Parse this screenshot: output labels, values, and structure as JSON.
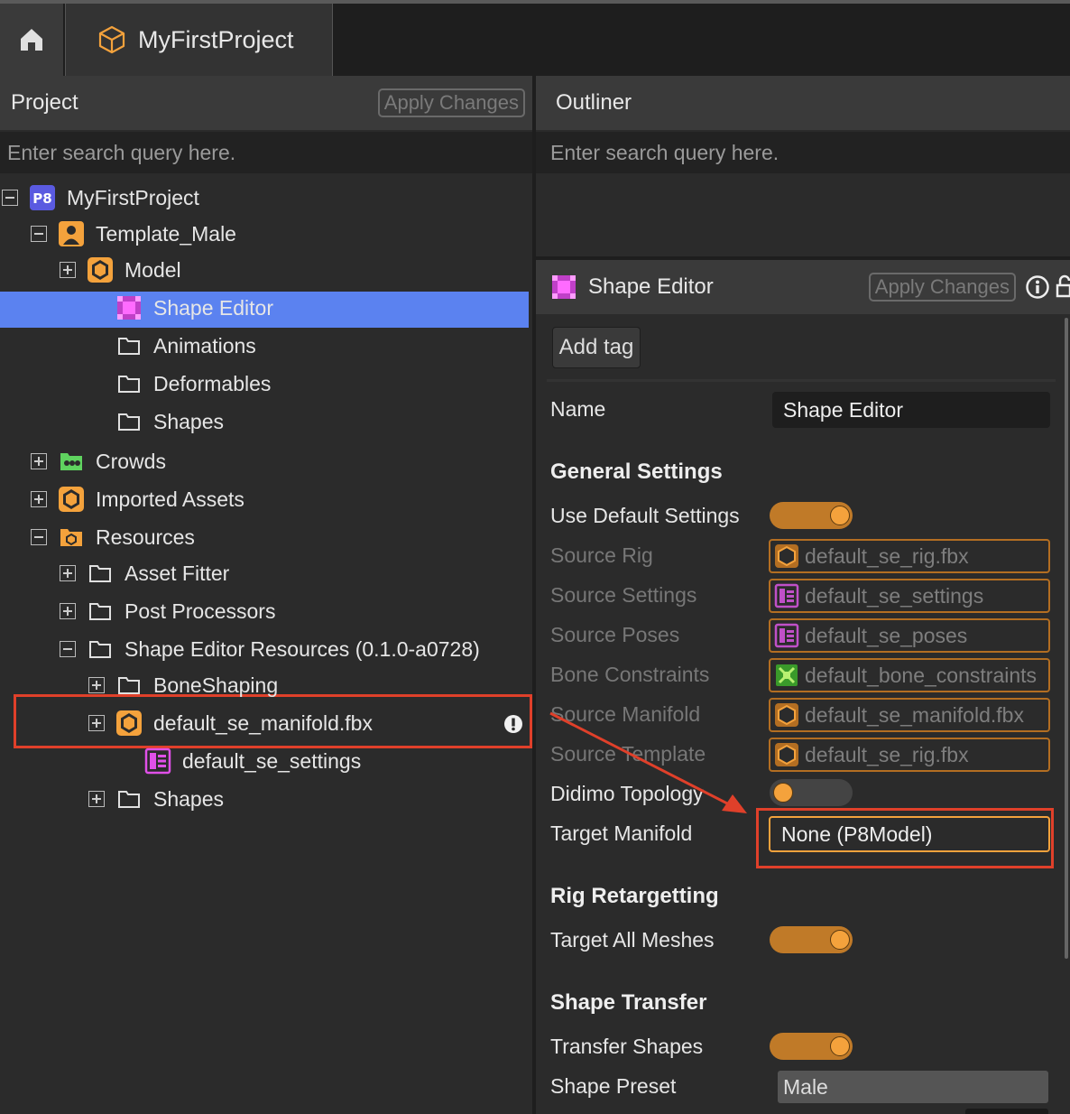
{
  "tab": {
    "title": "MyFirstProject"
  },
  "project_panel": {
    "title": "Project",
    "apply_label": "Apply Changes",
    "search_placeholder": "Enter search query here.",
    "tree": [
      {
        "label": "MyFirstProject",
        "icon": "p8-project-icon",
        "expander": "minus"
      },
      {
        "label": "Template_Male",
        "icon": "person-icon",
        "expander": "minus"
      },
      {
        "label": "Model",
        "icon": "hexagon-icon",
        "expander": "plus"
      },
      {
        "label": "Shape Editor",
        "icon": "shape-editor-icon",
        "expander": "none",
        "selected": true
      },
      {
        "label": "Animations",
        "icon": "folder-icon",
        "expander": "none"
      },
      {
        "label": "Deformables",
        "icon": "folder-icon",
        "expander": "none"
      },
      {
        "label": "Shapes",
        "icon": "folder-icon",
        "expander": "none"
      },
      {
        "label": "Crowds",
        "icon": "crowd-icon",
        "expander": "plus"
      },
      {
        "label": "Imported Assets",
        "icon": "hexagon-icon",
        "expander": "plus"
      },
      {
        "label": "Resources",
        "icon": "resources-folder-icon",
        "expander": "minus"
      },
      {
        "label": "Asset Fitter",
        "icon": "folder-icon",
        "expander": "plus"
      },
      {
        "label": "Post Processors",
        "icon": "folder-icon",
        "expander": "plus"
      },
      {
        "label": "Shape Editor Resources (0.1.0-a0728)",
        "icon": "folder-icon",
        "expander": "minus"
      },
      {
        "label": "BoneShaping",
        "icon": "folder-icon",
        "expander": "plus"
      },
      {
        "label": "default_se_manifold.fbx",
        "icon": "hexagon-icon",
        "expander": "plus",
        "warning": true
      },
      {
        "label": "default_se_settings",
        "icon": "settings-asset-icon",
        "expander": "none"
      },
      {
        "label": "Shapes",
        "icon": "folder-icon",
        "expander": "plus"
      }
    ]
  },
  "outliner": {
    "title": "Outliner",
    "search_placeholder": "Enter search query here."
  },
  "inspector": {
    "title": "Shape Editor",
    "apply_label": "Apply Changes",
    "add_tag_label": "Add tag",
    "name_label": "Name",
    "name_value": "Shape Editor",
    "general_settings": "General Settings",
    "use_default_settings": "Use Default Settings",
    "source_rig": {
      "label": "Source Rig",
      "value": "default_se_rig.fbx"
    },
    "source_settings": {
      "label": "Source Settings",
      "value": "default_se_settings"
    },
    "source_poses": {
      "label": "Source Poses",
      "value": "default_se_poses"
    },
    "bone_constraints": {
      "label": "Bone Constraints",
      "value": "default_bone_constraints"
    },
    "source_manifold": {
      "label": "Source Manifold",
      "value": "default_se_manifold.fbx"
    },
    "source_template": {
      "label": "Source Template",
      "value": "default_se_rig.fbx"
    },
    "didimo_topology": "Didimo Topology",
    "target_manifold": {
      "label": "Target Manifold",
      "value": "None (P8Model)"
    },
    "rig_retargetting": "Rig Retargetting",
    "target_all_meshes": "Target All Meshes",
    "shape_transfer": "Shape Transfer",
    "transfer_shapes": "Transfer Shapes",
    "shape_preset": {
      "label": "Shape Preset",
      "value": "Male"
    }
  },
  "colors": {
    "accent": "#f4a23c",
    "selection": "#5b82f0",
    "highlight": "#e0402a"
  }
}
